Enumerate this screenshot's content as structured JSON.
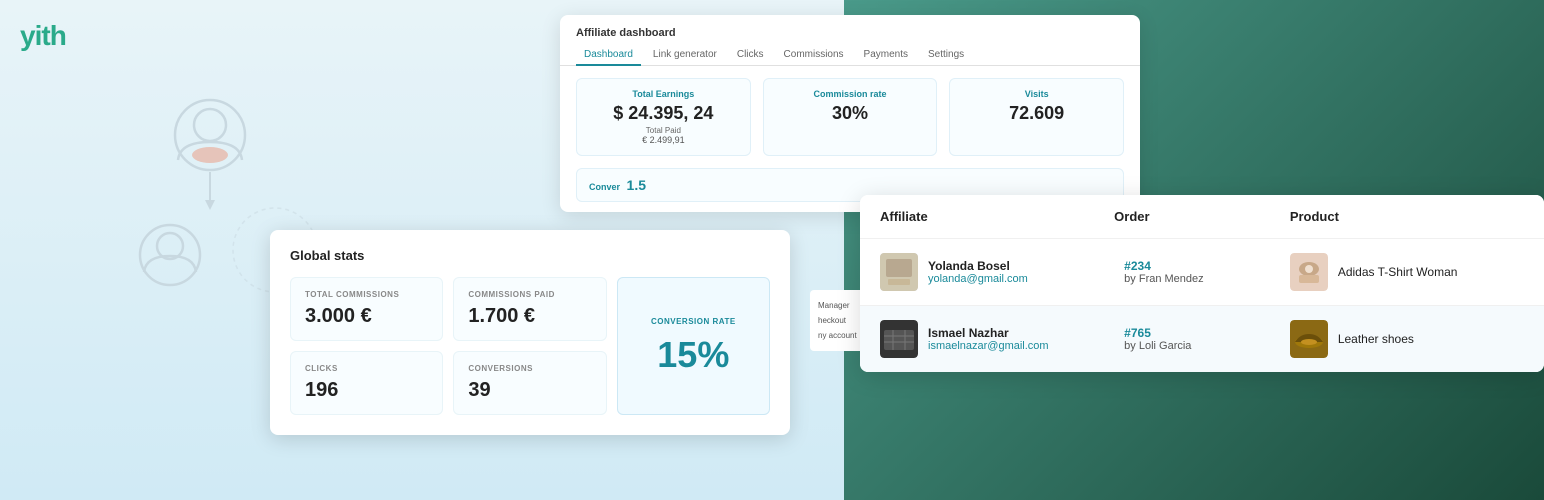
{
  "logo": {
    "text_yit": "yit",
    "text_h": "h"
  },
  "affiliate_dashboard": {
    "title": "Affiliate dashboard",
    "tabs": [
      {
        "label": "Dashboard",
        "active": true
      },
      {
        "label": "Link generator",
        "active": false
      },
      {
        "label": "Clicks",
        "active": false
      },
      {
        "label": "Commissions",
        "active": false
      },
      {
        "label": "Payments",
        "active": false
      },
      {
        "label": "Settings",
        "active": false
      }
    ],
    "total_earnings_label": "Total Earnings",
    "total_earnings_value": "$ 24.395, 24",
    "commission_rate_label": "Commission rate",
    "commission_rate_value": "30%",
    "visits_label": "Visits",
    "visits_value": "72.609",
    "total_paid_label": "Total Paid",
    "total_paid_value": "€ 2.499,91",
    "conversion_label": "Conver"
  },
  "global_stats": {
    "title": "Global stats",
    "total_commissions_label": "TOTAL COMMISSIONS",
    "total_commissions_value": "3.000 €",
    "commissions_paid_label": "COMMISSIONS PAID",
    "commissions_paid_value": "1.700 €",
    "clicks_label": "CLICKS",
    "clicks_value": "196",
    "conversions_label": "CONVERSIONS",
    "conversions_value": "39",
    "conversion_rate_label": "CONVERSION RATE",
    "conversion_rate_value": "15%"
  },
  "affiliate_table": {
    "headers": {
      "affiliate": "Affiliate",
      "order": "Order",
      "product": "Product"
    },
    "rows": [
      {
        "affiliate_name": "Yolanda Bosel",
        "affiliate_email": "yolanda@gmail.com",
        "order_number": "#234",
        "order_by": "by Fran Mendez",
        "product_name": "Adidas T-Shirt Woman"
      },
      {
        "affiliate_name": "Ismael Nazhar",
        "affiliate_email": "ismaelnazar@gmail.com",
        "order_number": "#765",
        "order_by": "by Loli Garcia",
        "product_name": "Leather shoes"
      }
    ]
  },
  "side_panel": {
    "items": [
      "Manager",
      "heckout",
      "ny account"
    ]
  }
}
